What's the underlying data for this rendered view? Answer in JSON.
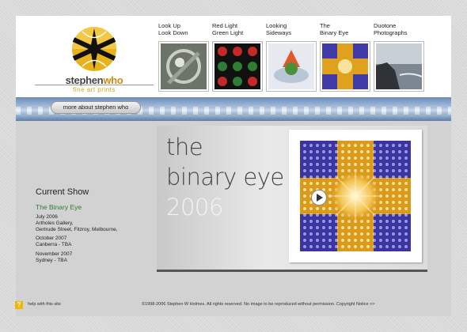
{
  "logo": {
    "word_a": "stephen",
    "word_b": "who",
    "tagline": "fine art prints"
  },
  "thumbnails": [
    {
      "line1": "Look Up",
      "line2": "Look Down",
      "icon": "metal-artwork"
    },
    {
      "line1": "Red Light",
      "line2": "Green Light",
      "icon": "red-green-grid-artwork"
    },
    {
      "line1": "Looking",
      "line2": "Sideways",
      "icon": "glass-sculpture-artwork"
    },
    {
      "line1": "The",
      "line2": "Binary Eye",
      "icon": "binary-eye-artwork"
    },
    {
      "line1": "Duotone",
      "line2": "Photographs",
      "icon": "coast-photo"
    }
  ],
  "nav": {
    "more_label": "more about stephen who"
  },
  "show": {
    "heading": "Current Show",
    "name": "The Binary Eye",
    "entries": [
      [
        "July 2006",
        "Artholes Gallery,",
        "Gertrude Street, Fitzroy, Melbourne,"
      ],
      [
        "October 2007",
        "Canberra - TBA"
      ],
      [
        "November 2007",
        "Sydney - TBA"
      ]
    ]
  },
  "feature": {
    "line1": "the",
    "line2": "binary eye",
    "year": "2006"
  },
  "footer": {
    "help": "help with this site",
    "copyright": "©1998-2006 Stephen W Holmes. All rights reserved. No image to be reproduced without permission. Copyright Notice >>"
  },
  "colors": {
    "accent_orange": "#d08a10",
    "show_green": "#2e7d32",
    "help_yellow": "#f2b705"
  }
}
